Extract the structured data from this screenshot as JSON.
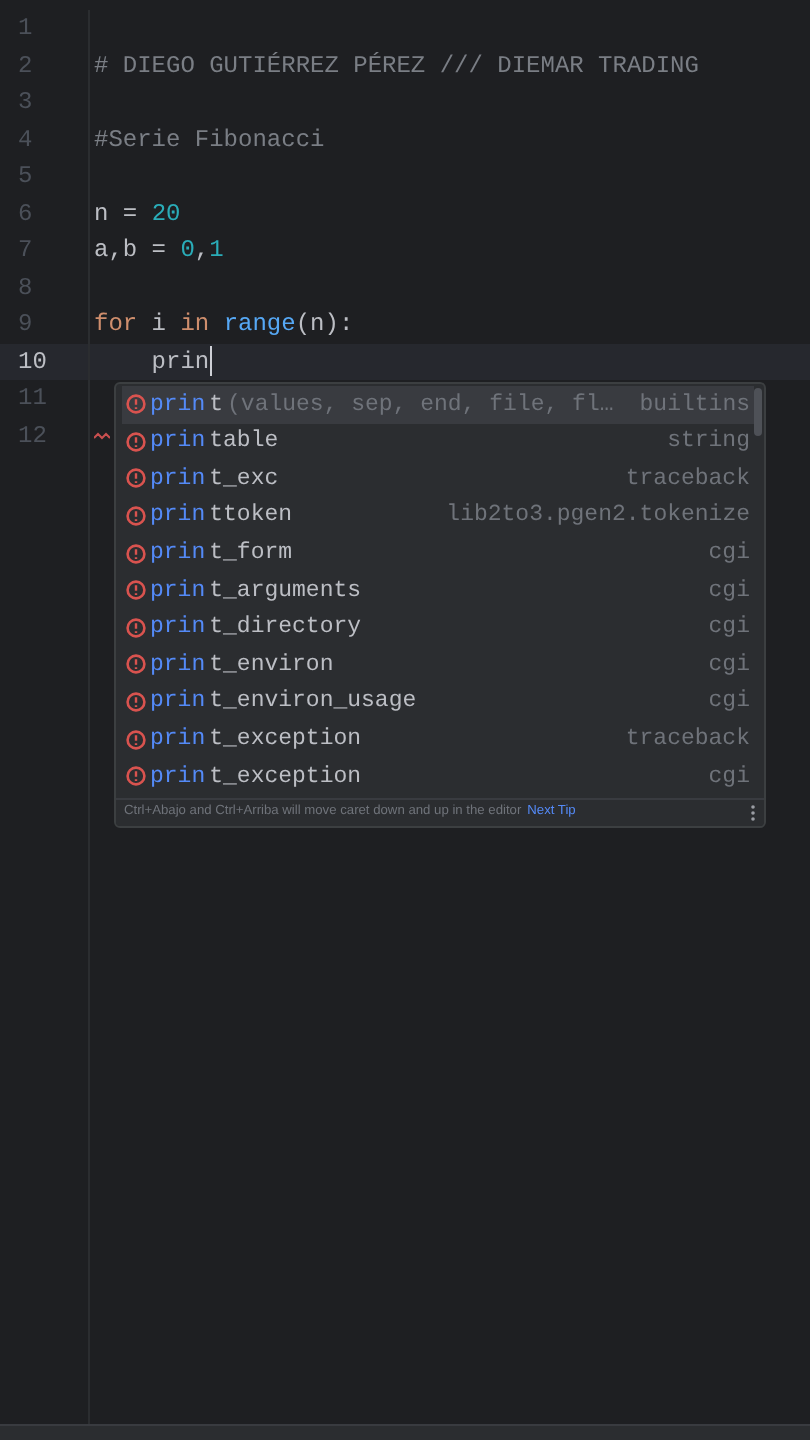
{
  "editor": {
    "lines": [
      {
        "number": "1",
        "current": false,
        "warning": false
      },
      {
        "number": "2",
        "current": false,
        "warning": false,
        "tokens": [
          {
            "kind": "comment",
            "text": "# DIEGO GUTIÉRREZ PÉREZ /// DIEMAR TRADING"
          }
        ]
      },
      {
        "number": "3",
        "current": false,
        "warning": false
      },
      {
        "number": "4",
        "current": false,
        "warning": false,
        "tokens": [
          {
            "kind": "comment",
            "text": "#Serie Fibonacci"
          }
        ]
      },
      {
        "number": "5",
        "current": false,
        "warning": false
      },
      {
        "number": "6",
        "current": false,
        "warning": false,
        "tokens": [
          {
            "kind": "plain",
            "text": "n = "
          },
          {
            "kind": "number",
            "text": "20"
          }
        ]
      },
      {
        "number": "7",
        "current": false,
        "warning": false,
        "tokens": [
          {
            "kind": "plain",
            "text": "a,b = "
          },
          {
            "kind": "number",
            "text": "0"
          },
          {
            "kind": "plain",
            "text": ","
          },
          {
            "kind": "number",
            "text": "1"
          }
        ]
      },
      {
        "number": "8",
        "current": false,
        "warning": false
      },
      {
        "number": "9",
        "current": false,
        "warning": false,
        "tokens": [
          {
            "kind": "keyword",
            "text": "for"
          },
          {
            "kind": "plain",
            "text": " i "
          },
          {
            "kind": "keyword",
            "text": "in"
          },
          {
            "kind": "builtin",
            "text": " range"
          },
          {
            "kind": "plain",
            "text": "(n):"
          }
        ]
      },
      {
        "number": "10",
        "current": true,
        "warning": false,
        "tokens": [
          {
            "kind": "plain",
            "text": "    prin"
          }
        ]
      },
      {
        "number": "11",
        "current": false,
        "warning": false
      },
      {
        "number": "12",
        "current": false,
        "warning": true
      }
    ]
  },
  "completion": {
    "items": [
      {
        "match": "prin",
        "rest": "t",
        "params": "(values, sep, end, file, fl…",
        "source": "builtins",
        "selected": true
      },
      {
        "match": "prin",
        "rest": "table",
        "source": "string",
        "selected": false
      },
      {
        "match": "prin",
        "rest": "t_exc",
        "source": "traceback",
        "selected": false
      },
      {
        "match": "prin",
        "rest": "ttoken",
        "source": "lib2to3.pgen2.tokenize",
        "selected": false
      },
      {
        "match": "prin",
        "rest": "t_form",
        "source": "cgi",
        "selected": false
      },
      {
        "match": "prin",
        "rest": "t_arguments",
        "source": "cgi",
        "selected": false
      },
      {
        "match": "prin",
        "rest": "t_directory",
        "source": "cgi",
        "selected": false
      },
      {
        "match": "prin",
        "rest": "t_environ",
        "source": "cgi",
        "selected": false
      },
      {
        "match": "prin",
        "rest": "t_environ_usage",
        "source": "cgi",
        "selected": false
      },
      {
        "match": "prin",
        "rest": "t_exception",
        "source": "traceback",
        "selected": false
      },
      {
        "match": "prin",
        "rest": "t_exception",
        "source": "cgi",
        "selected": false
      }
    ],
    "tip": "Ctrl+Abajo and Ctrl+Arriba will move caret down and up in the editor",
    "tip_link": "Next Tip"
  }
}
